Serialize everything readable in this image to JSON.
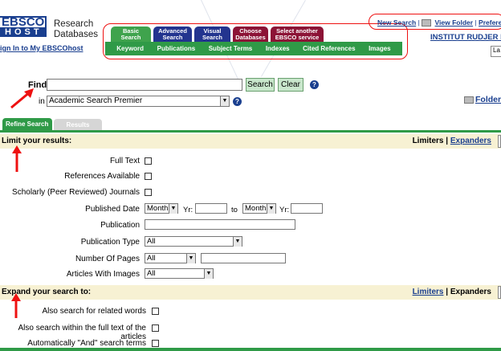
{
  "brand": {
    "logo_top": "EBSCO",
    "logo_bottom": "HOST",
    "line1": "Research",
    "line2": "Databases"
  },
  "top_tabs": [
    {
      "l1": "Basic",
      "l2": "Search",
      "color": "green"
    },
    {
      "l1": "Advanced",
      "l2": "Search",
      "color": "blue"
    },
    {
      "l1": "Visual",
      "l2": "Search",
      "color": "blue"
    },
    {
      "l1": "Choose",
      "l2": "Databases",
      "color": "maroon"
    },
    {
      "l1": "Select another",
      "l2": "EBSCO service",
      "color": "maroon"
    }
  ],
  "subnav": [
    "Keyword",
    "Publications",
    "Subject Terms",
    "Indexes",
    "Cited References",
    "Images"
  ],
  "signin": "ign In to My EBSCOhost",
  "toplinks": {
    "new_search": "New Search",
    "view_folder": "View Folder",
    "preferences": "Preferen"
  },
  "institution": "INSTITUT RUDJER BO",
  "language": "La",
  "search": {
    "find_label": "Find:",
    "query": "",
    "search_button": "Search",
    "clear_button": "Clear",
    "in_label": "in",
    "database": "Academic Search Premier"
  },
  "folder_link": "Folder i",
  "tabs": {
    "refine": "Refine Search",
    "results": "Results"
  },
  "limit": {
    "title": "Limit your results:",
    "limiters": "Limiters",
    "separator": "|",
    "expanders": "Expanders",
    "rows": {
      "full_text": "Full Text",
      "references": "References Available",
      "scholarly": "Scholarly (Peer Reviewed) Journals",
      "published_date": "Published Date",
      "month1": "Month",
      "yr1": "Yr:",
      "to": "to",
      "month2": "Month",
      "yr2": "Yr:",
      "publication": "Publication",
      "publication_type": "Publication Type",
      "publication_type_value": "All",
      "pages": "Number Of Pages",
      "pages_value": "All",
      "images": "Articles With Images",
      "images_value": "All"
    }
  },
  "expand": {
    "title": "Expand your search to:",
    "limiters": "Limiters",
    "separator": "|",
    "expanders": "Expanders",
    "rows": {
      "related": "Also search for related words",
      "fulltext": "Also search within the full text of the articles",
      "and_terms": "Automatically \"And\" search terms"
    }
  },
  "colors": {
    "green": "#2f9a47",
    "blue": "#23348f",
    "maroon": "#8c1336",
    "section_bg": "#f7f1d3",
    "annotation_red": "#e11111"
  }
}
